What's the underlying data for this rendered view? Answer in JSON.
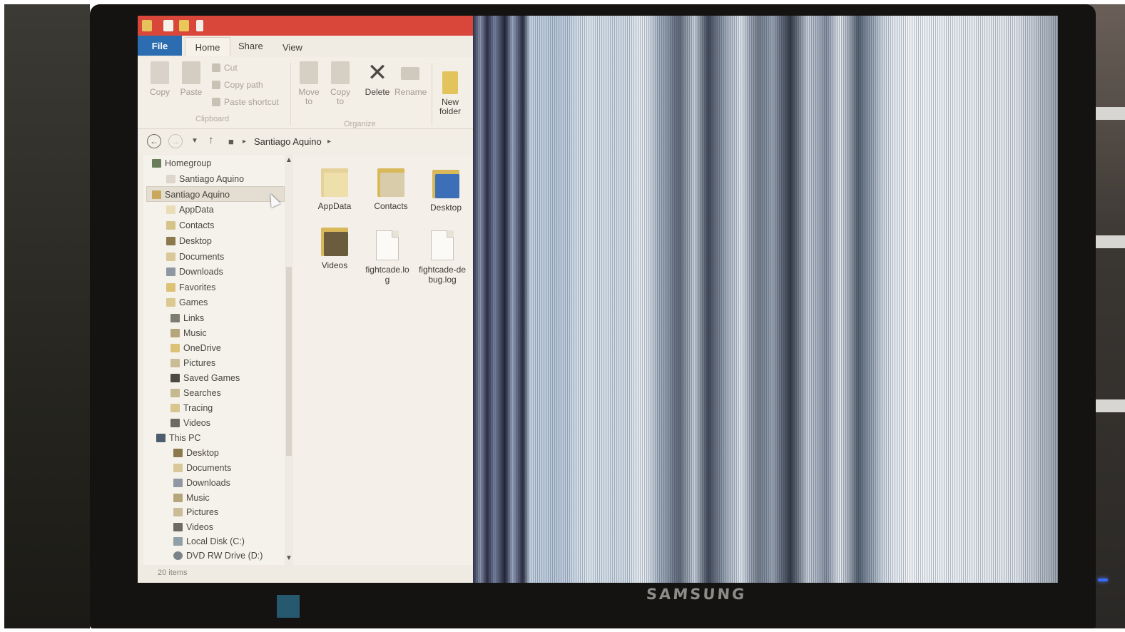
{
  "window": {
    "tabs": {
      "file": "File",
      "home": "Home",
      "share": "Share",
      "view": "View"
    }
  },
  "ribbon": {
    "clipboard": {
      "copy": "Copy",
      "paste": "Paste",
      "cut": "Cut",
      "copy_path": "Copy path",
      "paste_shortcut": "Paste shortcut",
      "group_label": "Clipboard"
    },
    "organize": {
      "move_to": "Move to",
      "copy_to": "Copy to",
      "delete": "Delete",
      "rename": "Rename",
      "group_label": "Organize"
    },
    "new": {
      "new_folder": "New folder"
    }
  },
  "addressbar": {
    "breadcrumb": "Santiago Aquino"
  },
  "nav_pane": {
    "items": [
      "Homegroup",
      "Santiago Aquino",
      "Santiago Aquino",
      "AppData",
      "Contacts",
      "Desktop",
      "Documents",
      "Downloads",
      "Favorites",
      "Games",
      "Links",
      "Music",
      "OneDrive",
      "Pictures",
      "Saved Games",
      "Searches",
      "Tracing",
      "Videos",
      "This PC",
      "Desktop",
      "Documents",
      "Downloads",
      "Music",
      "Pictures",
      "Videos",
      "Local Disk (C:)",
      "DVD RW Drive (D:)"
    ]
  },
  "content": {
    "files": [
      {
        "name": "AppData",
        "type": "folder"
      },
      {
        "name": "Contacts",
        "type": "folder"
      },
      {
        "name": "Desktop",
        "type": "folder"
      },
      {
        "name": "Videos",
        "type": "folder"
      },
      {
        "name": "fightcade.log",
        "type": "file"
      },
      {
        "name": "fightcade-debug.log",
        "type": "file"
      }
    ]
  },
  "status": {
    "items": "20 items"
  },
  "monitor": {
    "brand": "SAMSUNG"
  },
  "colors": {
    "titlebar": "#d9473b",
    "file_tab": "#2b6db0",
    "folder": "#ecd27a",
    "power_led": "#3a6bff"
  }
}
